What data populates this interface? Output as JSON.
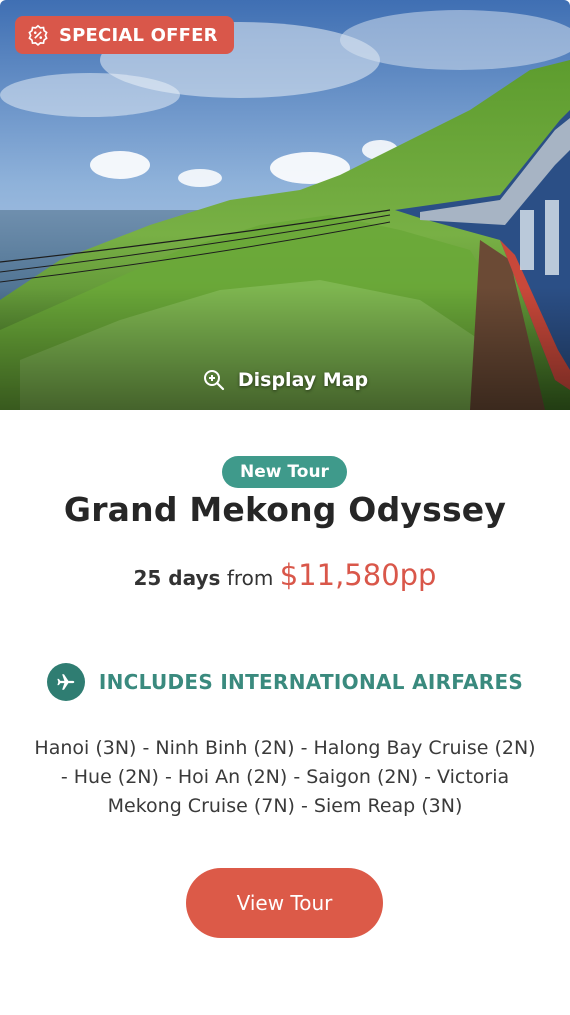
{
  "hero": {
    "badge_label": "SPECIAL OFFER",
    "badge_icon": "discount-badge-icon",
    "map_label": "Display Map",
    "map_icon": "zoom-in-icon"
  },
  "tour": {
    "tag": "New Tour",
    "title": "Grand Mekong Odyssey",
    "days": "25 days",
    "from": "from",
    "price": "$11,580pp"
  },
  "airfare": {
    "icon": "airplane-icon",
    "label": "INCLUDES INTERNATIONAL AIRFARES"
  },
  "itinerary": "Hanoi (3N) - Ninh Binh (2N) - Halong Bay Cruise (2N) - Hue (2N) - Hoi An (2N) - Saigon (2N) - Victoria Mekong Cruise (7N) - Siem Reap (3N)",
  "cta": {
    "label": "View Tour"
  },
  "colors": {
    "accent": "#d9574a",
    "teal": "#3f9a8b",
    "teal_dark": "#2f7d72"
  }
}
